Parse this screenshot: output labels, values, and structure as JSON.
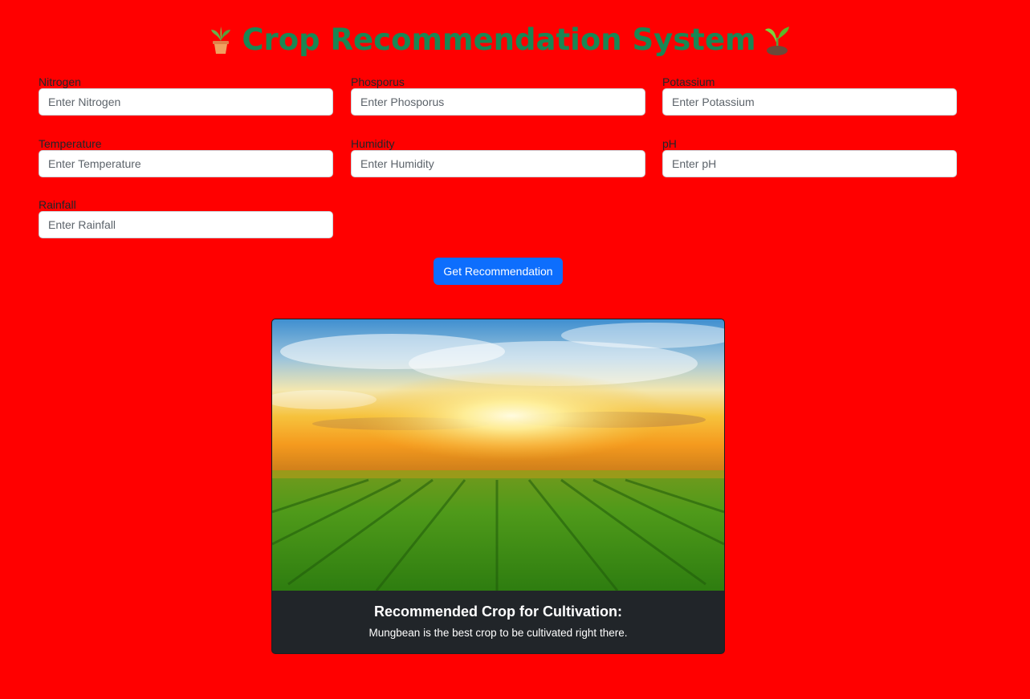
{
  "header": {
    "title": "Crop Recommendation System",
    "left_icon": "potted-plant-icon",
    "right_icon": "seedling-icon",
    "title_color": "#198754"
  },
  "form": {
    "fields": [
      {
        "label": "Nitrogen",
        "placeholder": "Enter Nitrogen",
        "value": ""
      },
      {
        "label": "Phosporus",
        "placeholder": "Enter Phosporus",
        "value": ""
      },
      {
        "label": "Potassium",
        "placeholder": "Enter Potassium",
        "value": ""
      },
      {
        "label": "Temperature",
        "placeholder": "Enter Temperature",
        "value": ""
      },
      {
        "label": "Humidity",
        "placeholder": "Enter Humidity",
        "value": ""
      },
      {
        "label": "pH",
        "placeholder": "Enter pH",
        "value": ""
      },
      {
        "label": "Rainfall",
        "placeholder": "Enter Rainfall",
        "value": ""
      }
    ],
    "submit_label": "Get Recommendation"
  },
  "result": {
    "title": "Recommended Crop for Cultivation:",
    "text": "Mungbean is the best crop to be cultivated right there."
  },
  "colors": {
    "background": "#ff0000",
    "button": "#0d6efd",
    "card": "#212529"
  }
}
